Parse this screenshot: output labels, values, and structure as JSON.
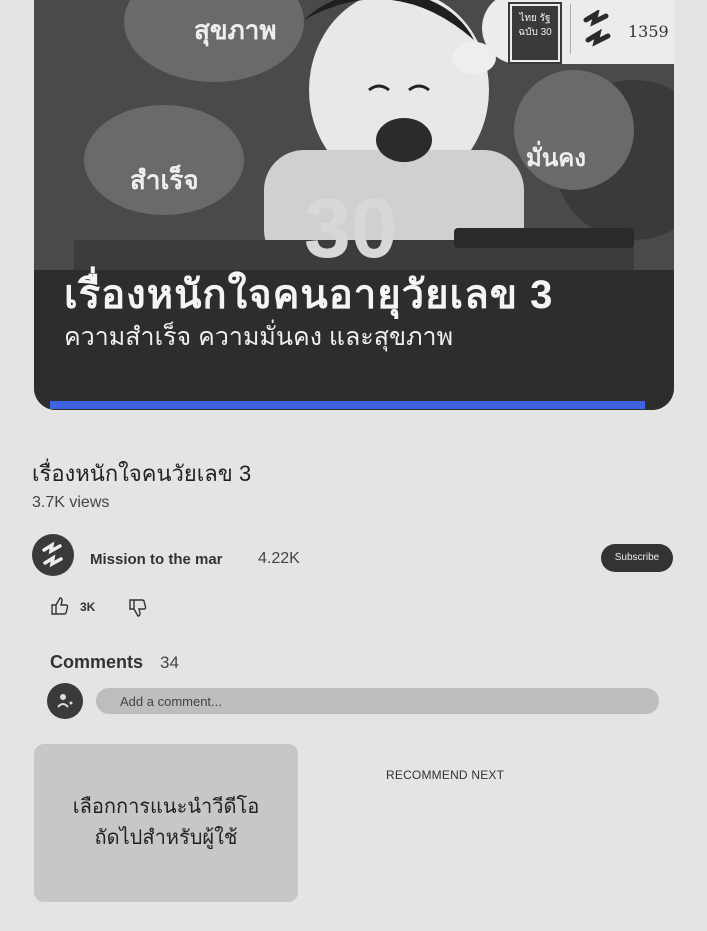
{
  "video": {
    "headline": "เรื่องหนักใจคนอายุวัยเลข 3",
    "subline": "ความสำเร็จ ความมั่นคง และสุขภาพ",
    "big_number": "30",
    "bubble_left_top": "สุขภาพ",
    "bubble_left": "สำเร็จ",
    "bubble_right": "มั่นคง",
    "badge_logo_text": "ไทย รัฐ ฉบับ 30",
    "badge_number": "1359",
    "progress_fraction": 0.93,
    "progress_color": "#3f63e0"
  },
  "meta": {
    "title": "เรื่องหนักใจคนวัยเลข 3",
    "views": "3.7K views"
  },
  "channel": {
    "name": "Mission to the mar",
    "subscribers": "4.22K",
    "subscribe_label": "Subscribe"
  },
  "reactions": {
    "likes": "3K",
    "like_icon": "thumbs-up-icon",
    "dislike_icon": "thumbs-down-icon"
  },
  "comments": {
    "label": "Comments",
    "count": "34",
    "placeholder": "Add a comment..."
  },
  "recommend": {
    "box_text_line1": "เลือกการแนะนำวีดีโอ",
    "box_text_line2": "ถัดไปสำหรับผู้ใช้",
    "next_label": "RECOMMEND NEXT"
  }
}
